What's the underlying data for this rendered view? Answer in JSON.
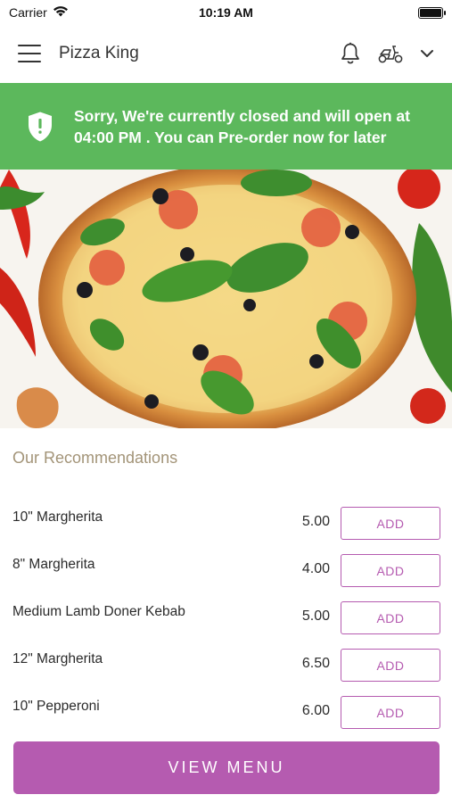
{
  "status_bar": {
    "carrier": "Carrier",
    "time": "10:19 AM"
  },
  "app_bar": {
    "title": "Pizza King",
    "icons": [
      "menu-icon",
      "bell-icon",
      "scooter-icon",
      "chevron-down-icon"
    ]
  },
  "banner": {
    "message": "Sorry, We're currently closed and will open at 04:00 PM . You can Pre-order now for later",
    "color": "#5cb85c",
    "icon": "shield-alert-icon"
  },
  "recommendations": {
    "title": "Our Recommendations",
    "items": [
      {
        "name": "10\" Margherita",
        "price": "5.00",
        "action": "ADD"
      },
      {
        "name": "8\" Margherita",
        "price": "4.00",
        "action": "ADD"
      },
      {
        "name": "Medium Lamb Doner Kebab",
        "price": "5.00",
        "action": "ADD"
      },
      {
        "name": "12\" Margherita",
        "price": "6.50",
        "action": "ADD"
      },
      {
        "name": "10\" Pepperoni",
        "price": "6.00",
        "action": "ADD"
      }
    ]
  },
  "footer": {
    "view_menu_label": "VIEW MENU"
  },
  "colors": {
    "accent": "#b55bb0",
    "section_title": "#a39478",
    "banner": "#5cb85c"
  }
}
